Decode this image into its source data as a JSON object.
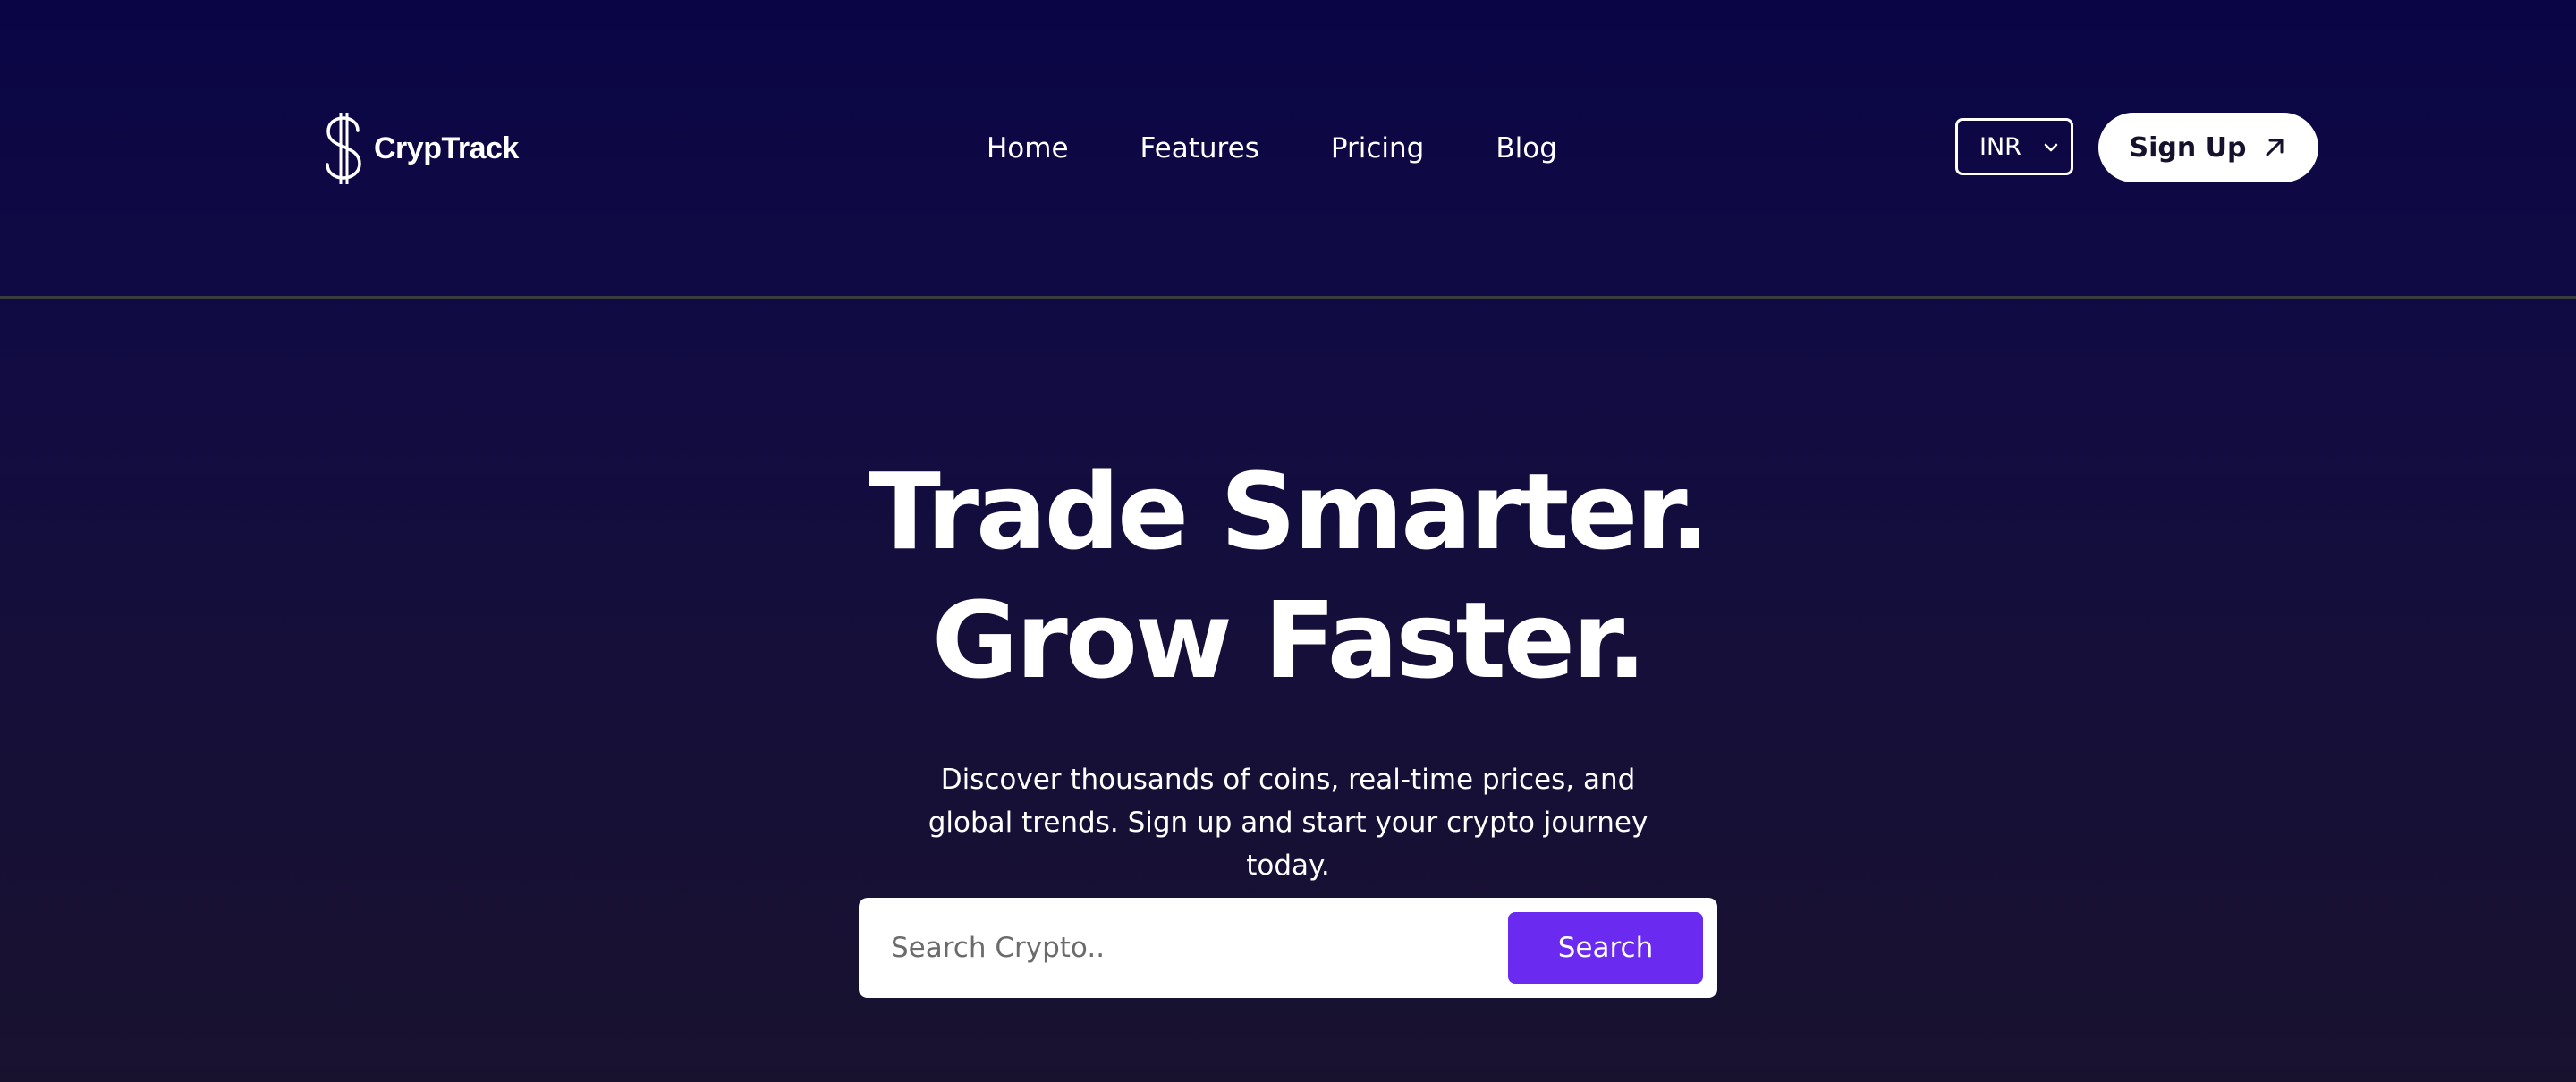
{
  "header": {
    "logo_text": "CrypTrack",
    "logo_icon": "dollar-sign-icon",
    "nav": [
      {
        "label": "Home"
      },
      {
        "label": "Features"
      },
      {
        "label": "Pricing"
      },
      {
        "label": "Blog"
      }
    ],
    "currency": {
      "selected": "INR",
      "icon": "chevron-down-icon"
    },
    "signup": {
      "label": "Sign Up",
      "icon": "arrow-up-right-icon"
    }
  },
  "hero": {
    "title_line1": "Trade Smarter.",
    "title_line2": "Grow Faster.",
    "subtitle": "Discover thousands of coins, real-time prices, and global trends. Sign up and start your crypto journey today."
  },
  "search": {
    "placeholder": "Search Crypto..",
    "value": "",
    "button_label": "Search"
  },
  "colors": {
    "background_top": "#0a0545",
    "background_bottom": "#19122f",
    "accent": "#6a2af0",
    "divider": "#3a3d3c"
  }
}
